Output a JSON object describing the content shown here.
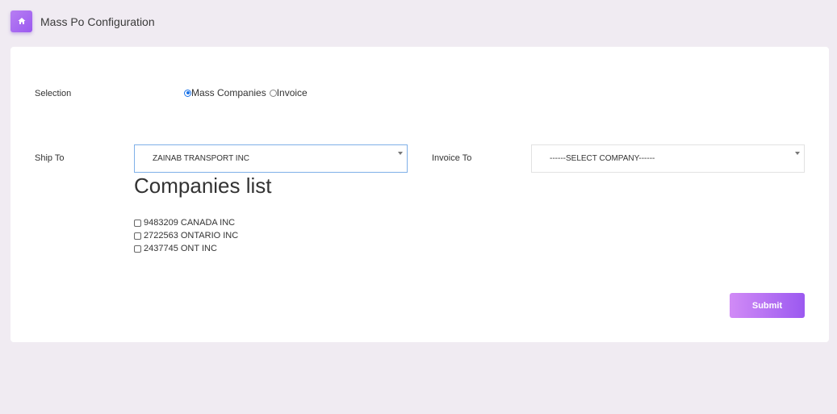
{
  "header": {
    "title": "Mass Po Configuration",
    "home_icon": "home-icon"
  },
  "form": {
    "selection_label": "Selection",
    "selection_options": [
      {
        "label": "Mass Companies",
        "checked": true
      },
      {
        "label": "Invoice",
        "checked": false
      }
    ],
    "ship_to_label": "Ship To",
    "ship_to_value": "ZAINAB TRANSPORT INC",
    "invoice_to_label": "Invoice To",
    "invoice_to_value": "------SELECT COMPANY------",
    "companies_title": "Companies list",
    "companies": [
      {
        "name": "9483209 CANADA INC",
        "checked": false
      },
      {
        "name": "2722563 ONTARIO INC",
        "checked": false
      },
      {
        "name": "2437745 ONT INC",
        "checked": false
      }
    ],
    "submit_label": "Submit"
  },
  "colors": {
    "accent_start": "#d18bf6",
    "accent_end": "#9b59f0",
    "background": "#f0ebf2",
    "radio_checked": "#1a73e8"
  }
}
